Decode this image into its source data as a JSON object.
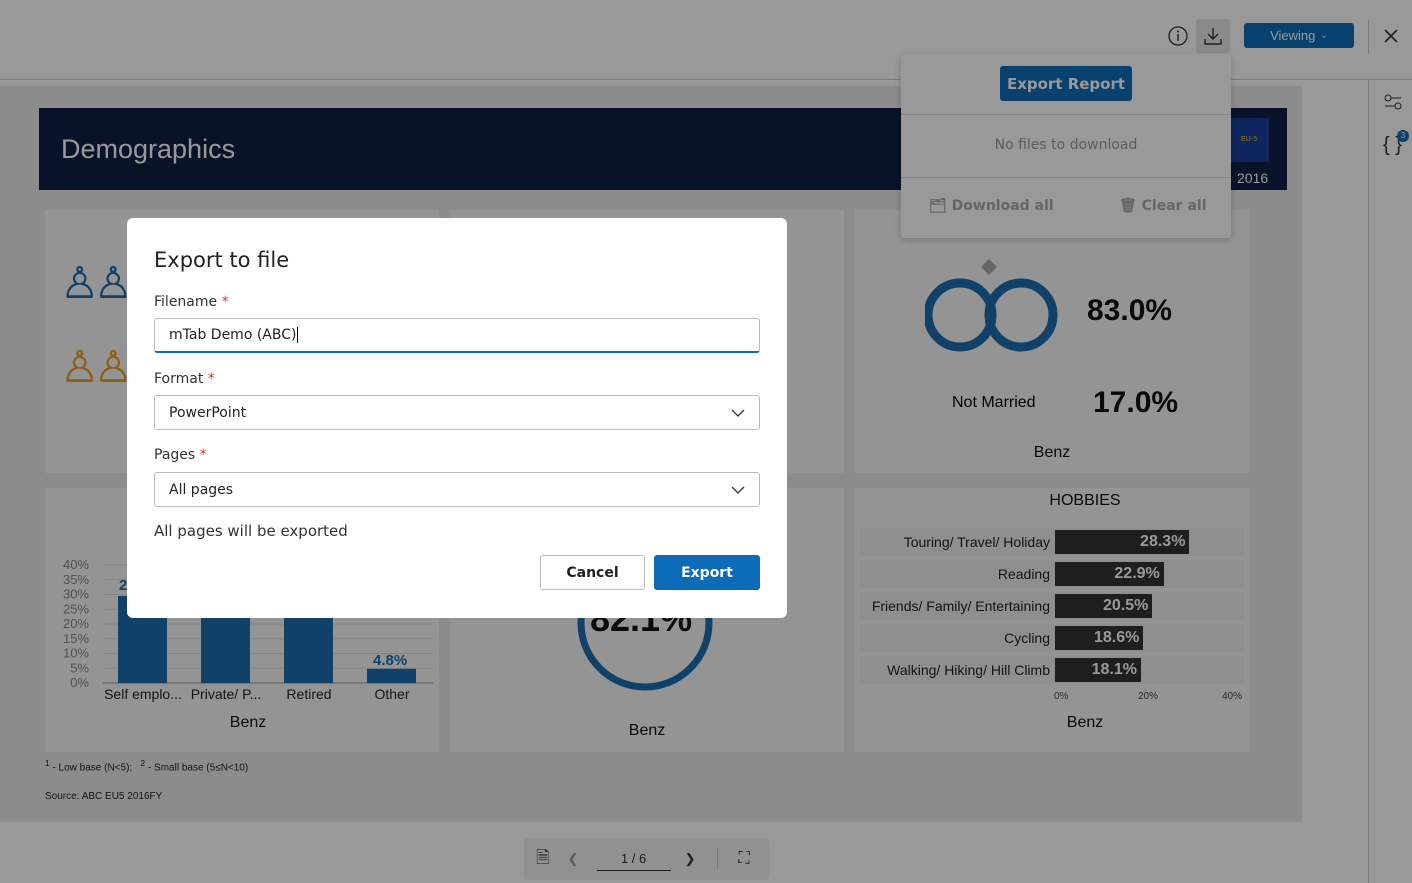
{
  "topbar": {
    "viewing_label": "Viewing",
    "info_icon": "info-icon",
    "download_icon": "download-icon",
    "close_icon": "close-icon"
  },
  "sidebar": {
    "filter_icon": "sliders-icon",
    "variables_icon": "braces-icon",
    "variables_badge": "3"
  },
  "export_popup": {
    "export_report_label": "Export Report",
    "empty_text": "No files to download",
    "download_all_label": "Download all",
    "clear_all_label": "Clear all"
  },
  "slide": {
    "title": "Demographics",
    "year": "2016",
    "logo_text": "EU-5",
    "marital": {
      "married_value": "83.0%",
      "not_married_label": "Not Married",
      "not_married_value": "17.0%",
      "benchmark": "Benz"
    },
    "employment": {
      "benchmark": "Benz",
      "first_label_partial": "2",
      "other_value": "4.8%"
    },
    "center": {
      "value_partial": "82.1%",
      "benchmark": "Benz"
    },
    "hobbies": {
      "title": "HOBBIES",
      "benchmark": "Benz"
    },
    "footnote_1": "- Low base (N<5);",
    "footnote_2": "- Small base (5≤N<10)",
    "source": "Source: ABC EU5 2016FY"
  },
  "chart_data": [
    {
      "type": "bar",
      "title": "",
      "xlabel": "Benz",
      "categories": [
        "Self emplo...",
        "Private/ P...",
        "Retired",
        "Other"
      ],
      "values": [
        29.5,
        null,
        null,
        4.8
      ],
      "yticks": [
        "40%",
        "35%",
        "30%",
        "25%",
        "20%",
        "15%",
        "10%",
        "5%",
        "0%"
      ],
      "ylim": [
        0,
        40
      ]
    },
    {
      "type": "bar",
      "orientation": "horizontal",
      "title": "HOBBIES",
      "xlabel": "Benz",
      "categories": [
        "Touring/ Travel/ Holiday",
        "Reading",
        "Friends/ Family/ Entertaining",
        "Cycling",
        "Walking/ Hiking/ Hill Climb"
      ],
      "values": [
        28.3,
        22.9,
        20.5,
        18.6,
        18.1
      ],
      "labels": [
        "28.3%",
        "22.9%",
        "20.5%",
        "18.6%",
        "18.1%"
      ],
      "xticks": [
        "0%",
        "20%",
        "40%"
      ],
      "xlim": [
        0,
        40
      ]
    }
  ],
  "pager": {
    "page": "1 / 6"
  },
  "modal": {
    "title": "Export to file",
    "filename_label": "Filename",
    "filename_value": "mTab Demo (ABC)",
    "format_label": "Format",
    "format_value": "PowerPoint",
    "pages_label": "Pages",
    "pages_value": "All pages",
    "hint": "All pages will be exported",
    "cancel_label": "Cancel",
    "export_label": "Export",
    "required_mark": "*"
  }
}
